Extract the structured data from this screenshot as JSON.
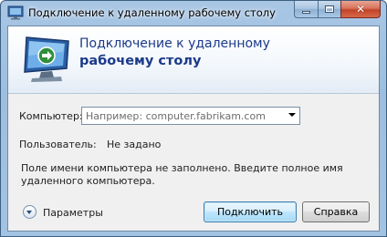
{
  "window": {
    "title": "Подключение к удаленному рабочему столу"
  },
  "banner": {
    "title_line1": "Подключение к удаленному",
    "title_line2": "рабочему столу"
  },
  "form": {
    "computer_label": "Компьютер:",
    "computer_placeholder": "Например: computer.fabrikam.com",
    "user_label": "Пользователь:",
    "user_value": "Не задано",
    "message": "Поле имени компьютера не заполнено. Введите полное имя удаленного компьютера."
  },
  "footer": {
    "params_label": "Параметры",
    "connect_label": "Подключить",
    "help_label": "Справка"
  },
  "colors": {
    "title_accent": "#1b3a8a",
    "default_button_border": "#3c7fb1",
    "close_button": "#c2432a"
  },
  "icons": [
    "rdp-monitor-icon",
    "minimize-icon",
    "maximize-icon",
    "close-icon",
    "chevron-down-icon",
    "expand-options-icon"
  ]
}
